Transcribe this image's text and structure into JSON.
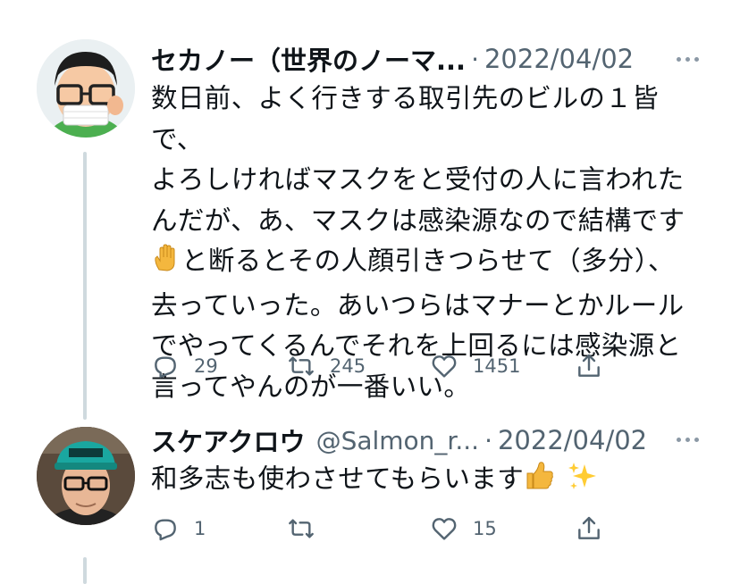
{
  "tweets": [
    {
      "author_name": "セカノー（世界のノーマ...",
      "handle": "",
      "separator": "·",
      "date": "2022/04/02",
      "text_lines": [
        "数日前、よく行きする取引先のビルの１皆で、",
        "よろしければマスクをと受付の人に言われた",
        "んだが、あ、マスクは感染源なので結構です",
        "と断るとその人顔引きつらせて（多分）、",
        "去っていった。あいつらはマナーとかルール",
        "でやってくるんでそれを上回るには感染源と",
        "言ってやんのが一番いい。"
      ],
      "inline_emoji": "raised-hand-emoji",
      "reply_count": "29",
      "retweet_count": "245",
      "like_count": "1451"
    },
    {
      "author_name": "スケアクロウ",
      "handle": "@Salmon_r...",
      "separator": "·",
      "date": "2022/04/02",
      "text_lines": [
        "和多志も使わさせてもらいます"
      ],
      "inline_emoji": [
        "thumbs-up-emoji",
        "sparkles-emoji"
      ],
      "reply_count": "1",
      "retweet_count": "",
      "like_count": "15"
    }
  ],
  "icons": [
    "reply-icon",
    "retweet-icon",
    "like-icon",
    "share-icon",
    "more-icon"
  ],
  "colors": {
    "text": "#0f1419",
    "secondary": "#536471",
    "thread_line": "#cfd9de",
    "background": "#ffffff"
  }
}
